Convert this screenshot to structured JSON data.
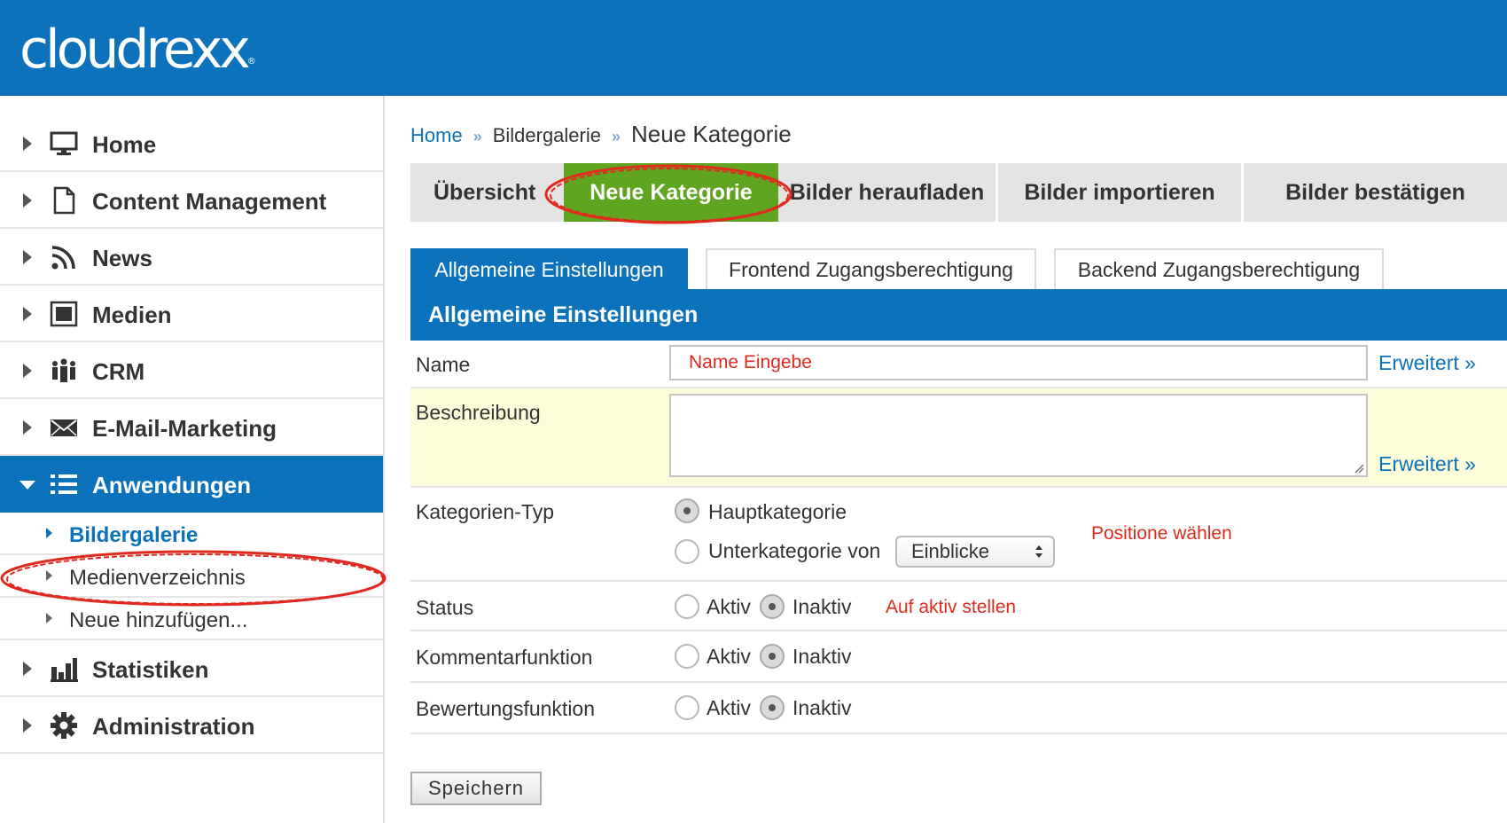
{
  "app": {
    "logo": "cloudrexx",
    "logo_mark": "®"
  },
  "colors": {
    "brand_blue": "#0b72bb",
    "active_tab_green": "#5fa51f",
    "annotation_red": "#e02a1f",
    "highlight_yellow": "#fcfcd9"
  },
  "sidebar": {
    "items": [
      {
        "label": "Home",
        "icon": "monitor-icon"
      },
      {
        "label": "Content Management",
        "icon": "document-icon"
      },
      {
        "label": "News",
        "icon": "rss-icon"
      },
      {
        "label": "Medien",
        "icon": "media-icon"
      },
      {
        "label": "CRM",
        "icon": "people-icon"
      },
      {
        "label": "E-Mail-Marketing",
        "icon": "envelope-icon"
      },
      {
        "label": "Anwendungen",
        "icon": "list-icon",
        "active": true
      },
      {
        "label": "Statistiken",
        "icon": "bar-chart-icon"
      },
      {
        "label": "Administration",
        "icon": "gear-icon"
      }
    ],
    "subitems": [
      {
        "label": "Bildergalerie",
        "current": true
      },
      {
        "label": "Medienverzeichnis"
      },
      {
        "label": "Neue hinzufügen..."
      }
    ]
  },
  "breadcrumb": {
    "home": "Home",
    "sep": "»",
    "section": "Bildergalerie",
    "current": "Neue Kategorie"
  },
  "tabs": [
    "Übersicht",
    "Neue Kategorie",
    "Bilder heraufladen",
    "Bilder importieren",
    "Bilder bestätigen"
  ],
  "subtabs": [
    "Allgemeine Einstellungen",
    "Frontend Zugangsberechtigung",
    "Backend Zugangsberechtigung"
  ],
  "section_title": "Allgemeine Einstellungen",
  "form": {
    "name_label": "Name",
    "name_value": "Name Eingebe",
    "description_label": "Beschreibung",
    "extended_link": "Erweitert »",
    "category_type_label": "Kategorien-Typ",
    "main_category": "Hauptkategorie",
    "sub_category_of": "Unterkategorie von",
    "parent_select_value": "Einblicke",
    "position_note": "Positione wählen",
    "status_label": "Status",
    "status_note": "Auf aktiv stellen",
    "comments_label": "Kommentarfunktion",
    "rating_label": "Bewertungsfunktion",
    "active": "Aktiv",
    "inactive": "Inaktiv",
    "save": "Speichern"
  }
}
